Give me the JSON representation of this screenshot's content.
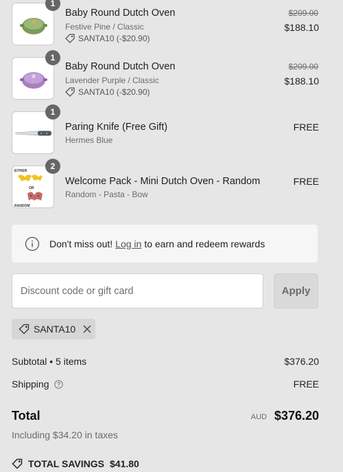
{
  "items": [
    {
      "qty": "1",
      "title": "Baby Round Dutch Oven",
      "variant": "Festive Pine / Classic",
      "discount": "SANTA10 (-$20.90)",
      "original_price": "$209.00",
      "price": "$188.10",
      "color": "#7c9a58"
    },
    {
      "qty": "1",
      "title": "Baby Round Dutch Oven",
      "variant": "Lavender Purple / Classic",
      "discount": "SANTA10 (-$20.90)",
      "original_price": "$209.00",
      "price": "$188.10",
      "color": "#a97fc0"
    },
    {
      "qty": "1",
      "title": "Paring Knife (Free Gift)",
      "variant": "Hermes Blue",
      "price": "FREE"
    },
    {
      "qty": "2",
      "title": "Welcome Pack - Mini Dutch Oven - Random",
      "variant": "Random - Pasta - Bow",
      "price": "FREE",
      "thumb_text": {
        "top": "EITHER",
        "mid": "OR",
        "bottom": "RANDOM"
      }
    }
  ],
  "notice": {
    "prefix": "Don't miss out!",
    "link": "Log in",
    "suffix": "to earn and redeem rewards"
  },
  "discount": {
    "placeholder": "Discount code or gift card",
    "apply_label": "Apply",
    "applied_code": "SANTA10"
  },
  "summary": {
    "subtotal_label": "Subtotal • 5 items",
    "subtotal_value": "$376.20",
    "shipping_label": "Shipping",
    "shipping_value": "FREE",
    "total_label": "Total",
    "currency": "AUD",
    "total_value": "$376.20",
    "taxes": "Including $34.20 in taxes",
    "savings_label": "TOTAL SAVINGS",
    "savings_value": "$41.80"
  }
}
